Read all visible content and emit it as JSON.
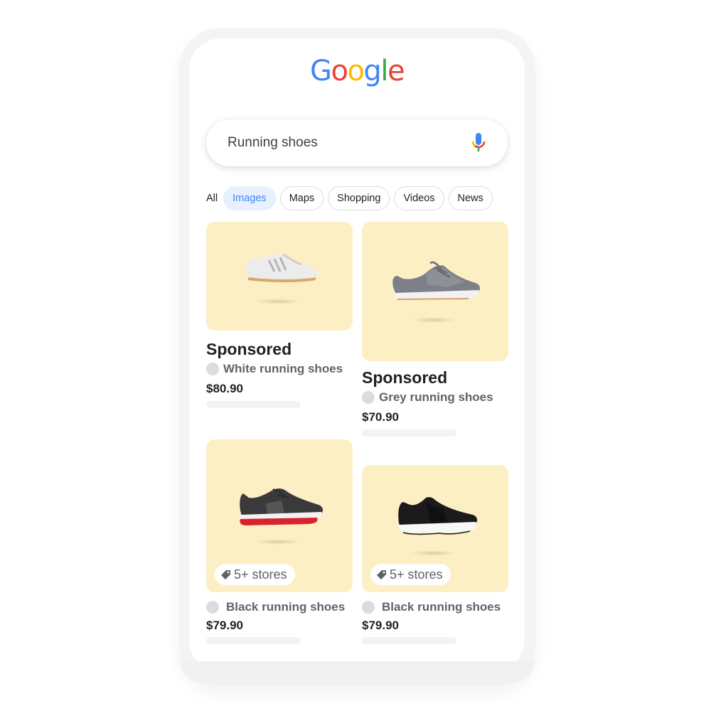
{
  "logo": {
    "letters": [
      "G",
      "o",
      "o",
      "g",
      "l",
      "e"
    ],
    "colors": [
      "#4285F4",
      "#EA4335",
      "#FBBC05",
      "#4285F4",
      "#34A853",
      "#EA4335"
    ]
  },
  "search": {
    "query": "Running shoes",
    "mic_icon": "microphone-icon"
  },
  "tabs": {
    "all": "All",
    "chips": [
      {
        "label": "Images",
        "active": true
      },
      {
        "label": "Maps",
        "active": false
      },
      {
        "label": "Shopping",
        "active": false
      },
      {
        "label": "Videos",
        "active": false
      },
      {
        "label": "News",
        "active": false
      }
    ]
  },
  "results": [
    {
      "label": "Sponsored",
      "merchant": "White running shoes",
      "price": "$80.90",
      "shoe": "white-sneaker"
    },
    {
      "label": "Sponsored",
      "merchant": "Grey running shoes",
      "price": "$70.90",
      "shoe": "grey-sneaker"
    },
    {
      "badge": "5+ stores",
      "badge_icon": "tag-icon",
      "merchant": "Black running shoes",
      "price": "$79.90",
      "shoe": "black-red-sneaker"
    },
    {
      "badge": "5+ stores",
      "badge_icon": "tag-icon",
      "merchant": "Black running shoes",
      "price": "$79.90",
      "shoe": "black-slip-on-sneaker"
    }
  ],
  "colors": {
    "accent": "#4285F4",
    "active_chip_bg": "#E8F0FE",
    "thumb_bg": "#FDEFC4",
    "text_primary": "#202124",
    "text_secondary": "#5F6368"
  }
}
